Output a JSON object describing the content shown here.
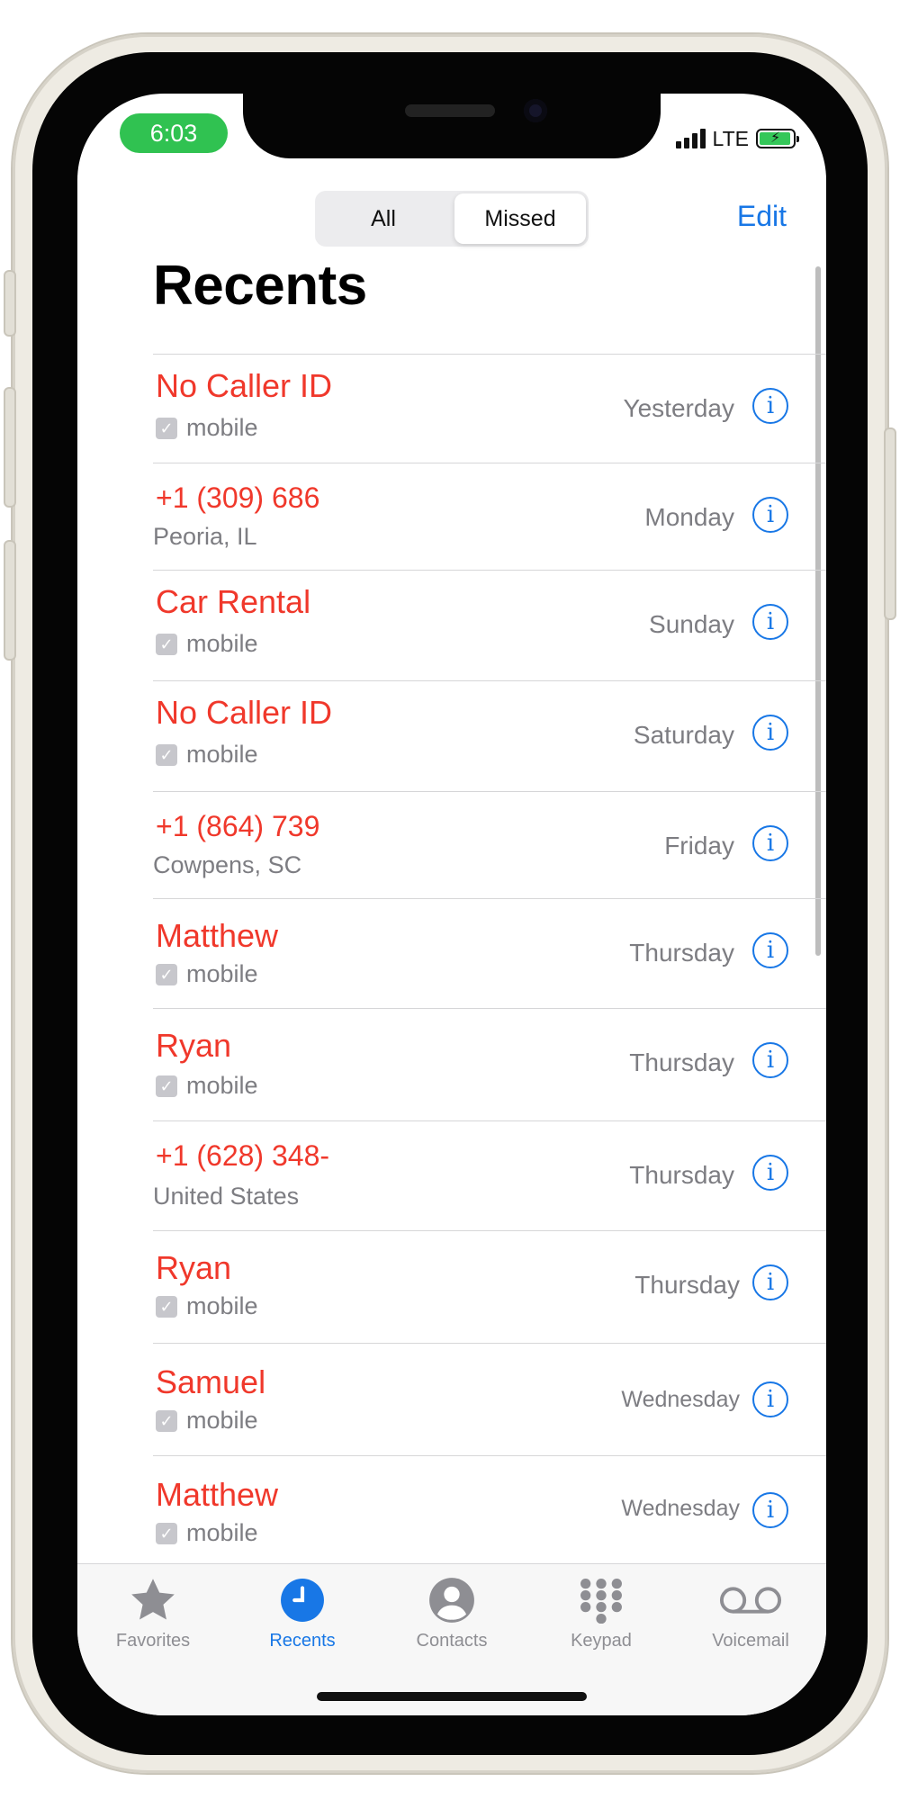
{
  "status": {
    "time": "6:03",
    "network": "LTE"
  },
  "header": {
    "segments": {
      "all": "All",
      "missed": "Missed"
    },
    "edit_label": "Edit",
    "title": "Recents"
  },
  "calls": [
    {
      "name": "No Caller ID",
      "sub": "mobile",
      "day": "Yesterday"
    },
    {
      "name": "+1 (309) 686",
      "sub": "Peoria, IL",
      "day": "Monday"
    },
    {
      "name": "Car Rental",
      "sub": "mobile",
      "day": "Sunday"
    },
    {
      "name": "No Caller ID",
      "sub": "mobile",
      "day": "Saturday"
    },
    {
      "name": "+1 (864) 739",
      "sub": "Cowpens, SC",
      "day": "Friday"
    },
    {
      "name": "Matthew",
      "sub": "mobile",
      "day": "Thursday"
    },
    {
      "name": "Ryan",
      "sub": "mobile",
      "day": "Thursday"
    },
    {
      "name": "+1 (628) 348-",
      "sub": "United States",
      "day": "Thursday"
    },
    {
      "name": "Ryan",
      "sub": "mobile",
      "day": "Thursday"
    },
    {
      "name": "Samuel",
      "sub": "mobile",
      "day": "Wednesday"
    },
    {
      "name": "Matthew",
      "sub": "mobile",
      "day": "Wednesday"
    }
  ],
  "tabs": {
    "favorites": "Favorites",
    "recents": "Recents",
    "contacts": "Contacts",
    "keypad": "Keypad",
    "voicemail": "Voicemail"
  },
  "colors": {
    "missed": "#f0382b",
    "accent": "#1877e6",
    "secondary": "#7d7d82",
    "time_pill": "#30c251"
  }
}
